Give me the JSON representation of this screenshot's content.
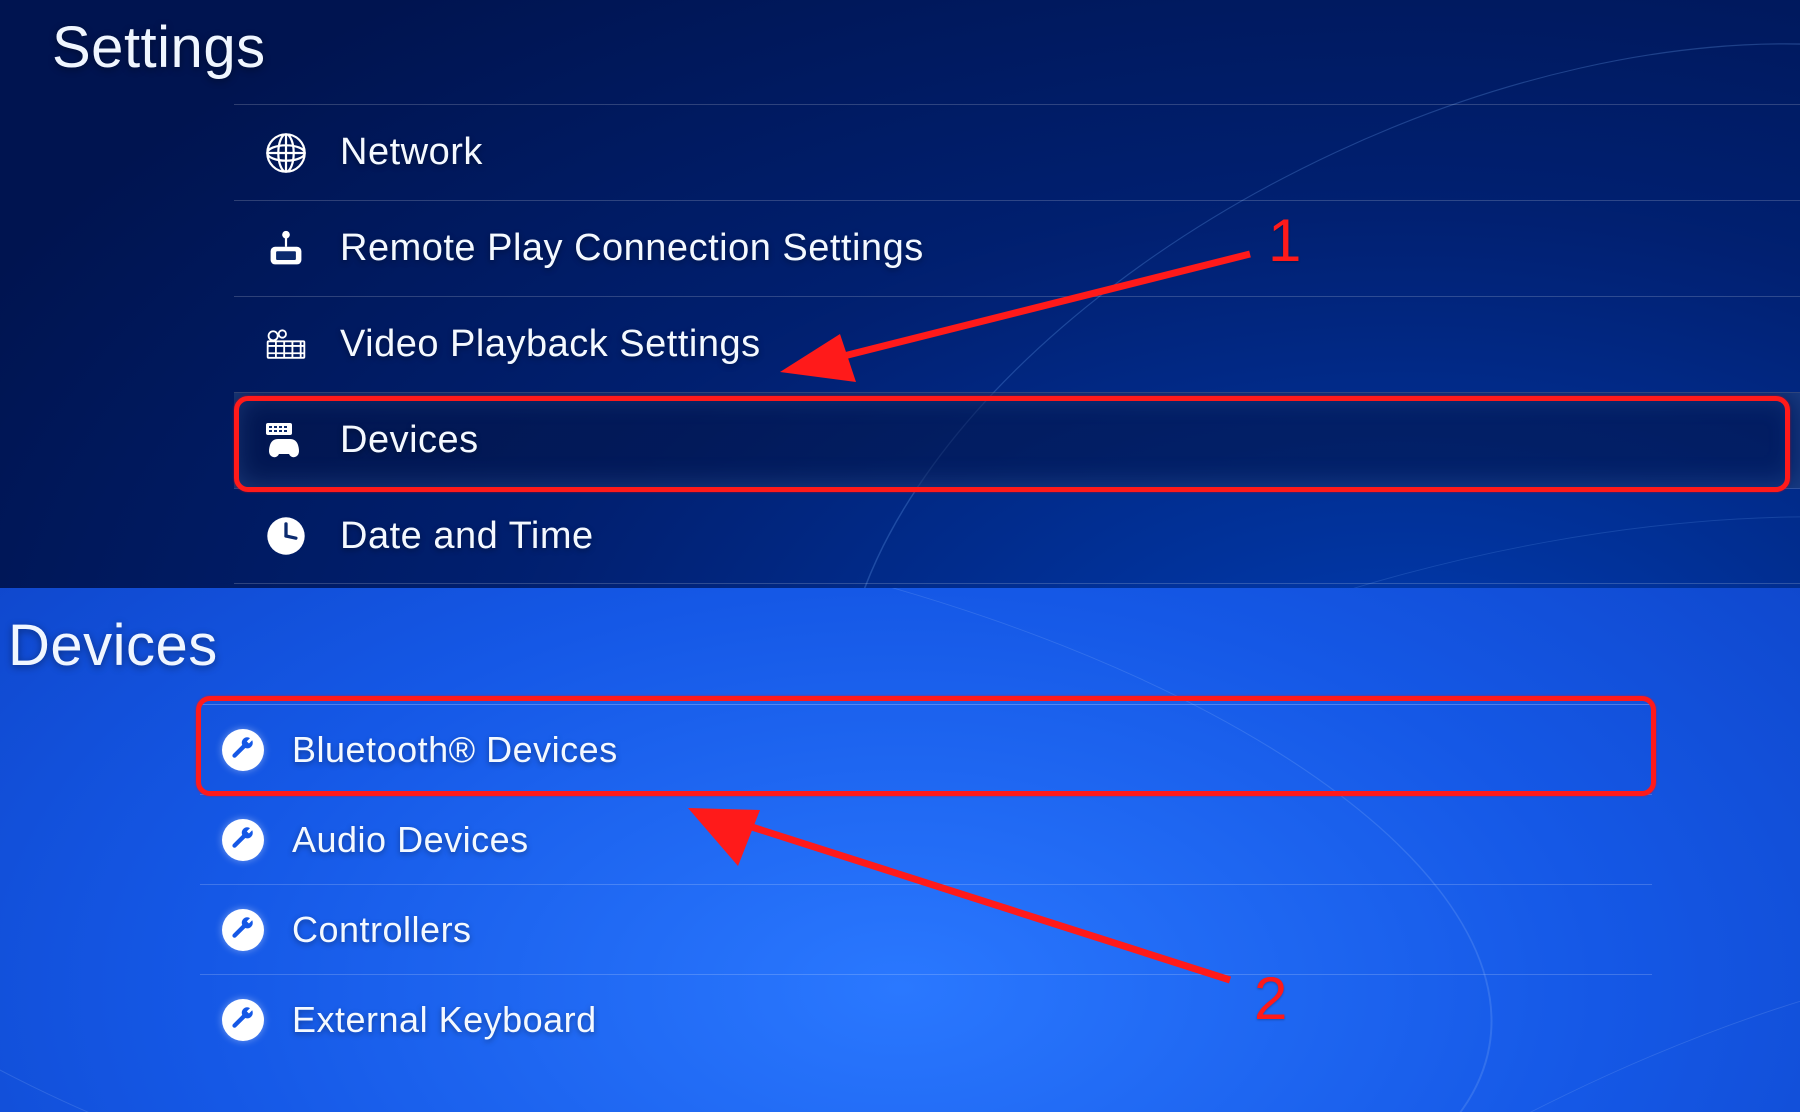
{
  "panels": {
    "settings": {
      "title": "Settings",
      "items": [
        {
          "label": "Network",
          "icon": "globe-icon"
        },
        {
          "label": "Remote Play Connection Settings",
          "icon": "remote-play-icon"
        },
        {
          "label": "Video Playback Settings",
          "icon": "film-icon"
        },
        {
          "label": "Devices",
          "icon": "devices-icon"
        },
        {
          "label": "Date and Time",
          "icon": "clock-icon"
        }
      ],
      "highlighted_index": 3
    },
    "devices": {
      "title": "Devices",
      "items": [
        {
          "label": "Bluetooth® Devices",
          "icon": "wrench-icon"
        },
        {
          "label": "Audio Devices",
          "icon": "wrench-icon"
        },
        {
          "label": "Controllers",
          "icon": "wrench-icon"
        },
        {
          "label": "External Keyboard",
          "icon": "wrench-icon"
        }
      ],
      "highlighted_index": 0
    }
  },
  "annotations": {
    "step1": "1",
    "step2": "2",
    "highlight_color": "#ff1a1a"
  }
}
